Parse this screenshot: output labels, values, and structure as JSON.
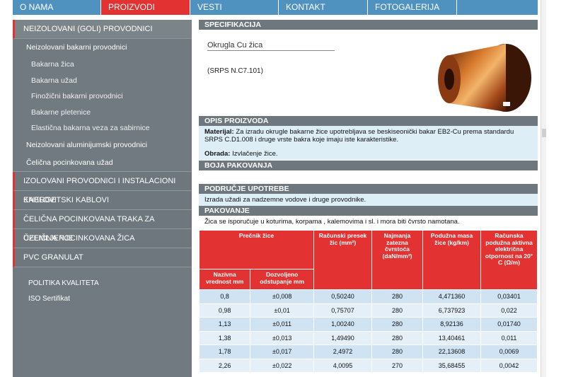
{
  "nav": [
    {
      "label": "O NAMA",
      "width": 125
    },
    {
      "label": "PROIZVODI",
      "width": 126,
      "active": true
    },
    {
      "label": "VESTI",
      "width": 125
    },
    {
      "label": "KONTAKT",
      "width": 126
    },
    {
      "label": "FOTOGALERIJA",
      "width": 126
    },
    {
      "label": "",
      "width": 114
    }
  ],
  "sidebar": {
    "cat_first": "NEIZOLOVANI (GOLI) PROVODNICI",
    "sub_copper": "Neizolovani bakarni provodnici",
    "copper_items": [
      "Bakarna žica",
      "Bakarna užad",
      "Finožični bakarni provodnici",
      "Bakarne pletenice",
      "Elastična bakarna veza za sabirnice"
    ],
    "sub_alu": "Neizolovani aluminijumski provodnici",
    "sub_steel": "Čelična pocinkovana užad",
    "categories": [
      "IZOLOVANI PROVODNICI I INSTALACIONI KABLOVI",
      "ENERGETSKI KABLOVI",
      "ČELIČNA POCINKOVANA TRAKA ZA UZEMLJENJE",
      "ČELIČNA POCINKOVANA ŽICA",
      "PVC GRANULAT"
    ],
    "links": [
      "POLITIKA KVALITETA",
      "ISO Sertifikat"
    ]
  },
  "main": {
    "spec_head": "SPECIFIKACIJA",
    "product_title": "Okrugla Cu žica",
    "product_std": "(SRPS N.C7.101)",
    "opis_head": "OPIS PROIZVODA",
    "materijal_label": "Materijal:",
    "materijal_text": " Za izradu okrugle bakarne žice upotrebljava se beskiseonički bakar EB2-Cu prema standardu SRPS C.D1.008 i druge vrste bakra koje imaju iste karakteristike.",
    "obrada_label": "Obrada:",
    "obrada_text": " Izvlačenje žice.",
    "boja_head": "BOJA PAKOVANJA",
    "podrucje_head": "PODRUČJE UPOTREBE",
    "podrucje_text": "Izrada užadi za nadzemne vodove i druge provodnike.",
    "pakovanje_head": "PAKOVANJE",
    "pakovanje_text": "Žica se isporučuje u koturima, korpama , kalemovima i sl. i mora biti čvrsto namotana."
  },
  "table": {
    "h_precnik": "Prečnik žice",
    "h_presek": "Računski presek žic (mm²)",
    "h_cvrstoca": "Najmanja zatezna čvrstoća (daN/mm²)",
    "h_masa": "Podužna masa žice (kg/km)",
    "h_otpornost": "Računska podužna aktivna električna otpornost na 20° C  (Ω/m)",
    "h_nazivna": "Nazivna vrednost mm",
    "h_dozvoljeno": "Dozvoljeno odstupanje mm",
    "rows": [
      [
        "0,8",
        "±0,008",
        "0,50240",
        "280",
        "4,471360",
        "0,03401"
      ],
      [
        "0,98",
        "±0,01",
        "0,75707",
        "280",
        "6,737923",
        "0,022"
      ],
      [
        "1,13",
        "±0,011",
        "1,00240",
        "280",
        "8,92136",
        "0,01740"
      ],
      [
        "1,38",
        "±0,013",
        "1,49490",
        "280",
        "13,40461",
        "0,011"
      ],
      [
        "1,78",
        "±0,017",
        "2,4972",
        "280",
        "22,13608",
        "0,0069"
      ],
      [
        "2,26",
        "±0,022",
        "4,0095",
        "270",
        "35,68455",
        "0,0042"
      ]
    ]
  }
}
